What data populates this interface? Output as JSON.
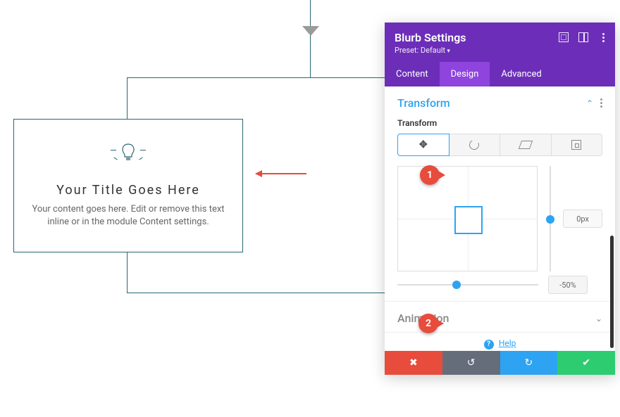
{
  "blurb": {
    "title": "Your Title Goes Here",
    "desc": "Your content goes here. Edit or remove this text inline or in the module Content settings."
  },
  "panel": {
    "title": "Blurb Settings",
    "preset": "Preset: Default",
    "tabs": {
      "content": "Content",
      "design": "Design",
      "advanced": "Advanced"
    },
    "transform": {
      "section_label": "Transform",
      "sub_label": "Transform",
      "y_value": "0px",
      "x_value": "-50%"
    },
    "animation": {
      "section_label": "Animation"
    },
    "help": "Help"
  },
  "callouts": {
    "one": "1",
    "two": "2"
  },
  "icons": {
    "expand_corners": "expand-corners",
    "split_view": "split-view",
    "more_vert": "more-vertical",
    "move": "move",
    "rotate": "rotate",
    "skew": "skew",
    "origin": "origin",
    "close": "✖",
    "undo": "↺",
    "redo": "↻",
    "check": "✔",
    "help": "?"
  }
}
